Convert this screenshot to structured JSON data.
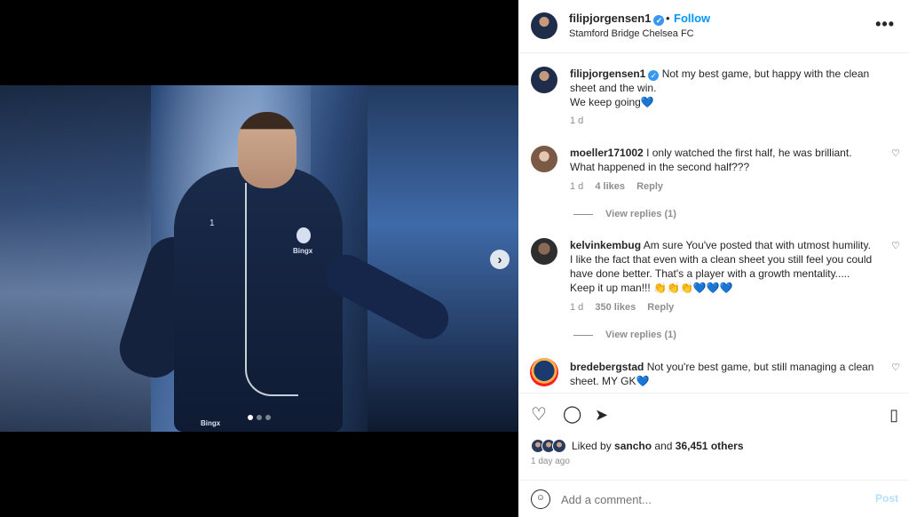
{
  "post": {
    "username": "filipjorgensen1",
    "verified_mark": "✓",
    "separator": "•",
    "follow_label": "Follow",
    "location": "Stamford Bridge Chelsea FC",
    "more_icon": "more-icon",
    "photo": {
      "jersey_number": "1",
      "brand_text": "Bingx",
      "brand_text_bottom": "Bingx",
      "carousel_dots": 3,
      "active_dot": 1
    },
    "next_glyph": "›"
  },
  "caption": {
    "username": "filipjorgensen1",
    "text": "Not my best game, but happy with the clean sheet and the win.",
    "text2": "We keep going💙",
    "time": "1 d"
  },
  "comments": [
    {
      "username": "moeller171002",
      "text": "I only watched the first half, he was brilliant. What happened in the second half???",
      "time": "1 d",
      "likes": "4 likes",
      "reply_label": "Reply",
      "view_replies": "View replies (1)"
    },
    {
      "username": "kelvinkembug",
      "text": "Am sure You've posted that with utmost humility. I like the fact that even with a clean sheet you still feel you could have done better. That's a player with a growth mentality..... Keep it up man!!! 👏👏👏💙💙💙",
      "time": "1 d",
      "likes": "350 likes",
      "reply_label": "Reply",
      "view_replies": "View replies (1)"
    },
    {
      "username": "bredebergstad",
      "text": "Not you're best game, but still managing a clean sheet. MY GK💙"
    }
  ],
  "actions": {
    "like_icon": "heart-icon",
    "comment_icon": "comment-icon",
    "share_icon": "share-icon",
    "save_icon": "bookmark-icon"
  },
  "likes": {
    "prefix": "Liked by",
    "user": "sancho",
    "and": "and",
    "others": "36,451 others"
  },
  "posted_time": "1 day ago",
  "add_comment": {
    "placeholder": "Add a comment...",
    "post_label": "Post"
  }
}
